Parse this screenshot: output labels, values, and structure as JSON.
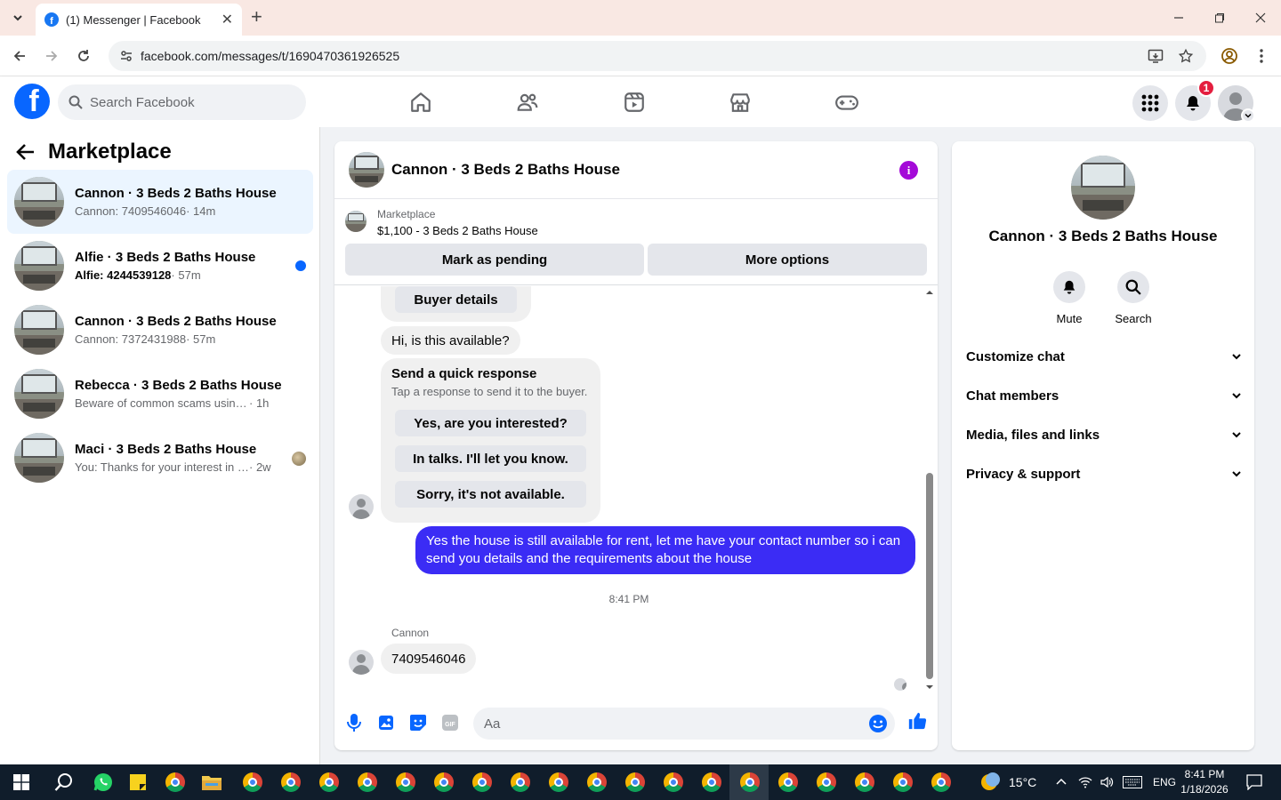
{
  "browser": {
    "tab_title": "(1) Messenger | Facebook",
    "favicon_letter": "f",
    "url": "facebook.com/messages/t/1690470361926525"
  },
  "fb": {
    "logo_letter": "f",
    "search_placeholder": "Search Facebook",
    "notification_count": "1"
  },
  "left": {
    "title": "Marketplace",
    "conversations": [
      {
        "name": "Cannon · 3 Beds 2 Baths House",
        "snippet": "Cannon: 7409546046",
        "time": " · 14m",
        "unread": false
      },
      {
        "name": "Alfie · 3 Beds 2 Baths House",
        "snippet": "Alfie: 4244539128",
        "time": " · 57m",
        "unread": true
      },
      {
        "name": "Cannon · 3 Beds 2 Baths House",
        "snippet": "Cannon: 7372431988",
        "time": " · 57m",
        "unread": false
      },
      {
        "name": "Rebecca · 3 Beds 2 Baths House",
        "snippet": "Beware of common scams using pay...",
        "time": " · 1h",
        "unread": false
      },
      {
        "name": "Maci · 3 Beds 2 Baths House",
        "snippet": "You: Thanks for your interest in the...",
        "time": " · 2w",
        "unread": false
      }
    ]
  },
  "chat": {
    "title": "Cannon · 3 Beds 2 Baths House",
    "marketplace_label": "Marketplace",
    "listing": "$1,100 - 3 Beds 2 Baths House",
    "mark_pending": "Mark as pending",
    "more_options": "More options",
    "buyer_details": "Buyer details",
    "incoming_1": "Hi, is this available?",
    "quick_title": "Send a quick response",
    "quick_sub": "Tap a response to send it to the buyer.",
    "quick_responses": [
      "Yes, are you interested?",
      "In talks. I'll let you know.",
      "Sorry, it's not available."
    ],
    "outgoing": "Yes the house is still available for rent, let me have your contact number so i can send you details and the requirements about the house",
    "timestamp": "8:41 PM",
    "sender_name": "Cannon",
    "incoming_2": "7409546046",
    "composer_placeholder": "Aa"
  },
  "rightpanel": {
    "title": "Cannon · 3 Beds 2 Baths House",
    "mute": "Mute",
    "search": "Search",
    "sections": [
      "Customize chat",
      "Chat members",
      "Media, files and links",
      "Privacy & support"
    ]
  },
  "taskbar": {
    "temperature": "15°C",
    "lang": "ENG",
    "time": "8:41 PM",
    "date": "1/18/2026"
  },
  "colors": {
    "fb_blue": "#0866ff",
    "outgoing_bubble": "#3b2cf5",
    "info_purple": "#a40ad8",
    "badge_red": "#e41e3f"
  }
}
